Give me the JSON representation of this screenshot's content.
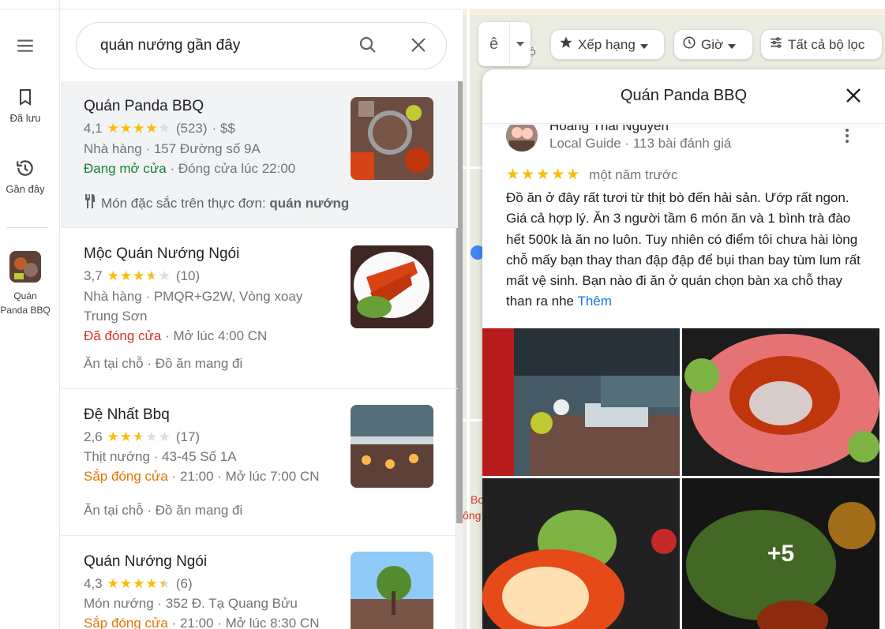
{
  "rail": {
    "saved_label": "Đã lưu",
    "recent_label": "Gần đây",
    "recent_place_label": "Quán Panda BBQ"
  },
  "search": {
    "value": "quán nướng gần đây"
  },
  "results": [
    {
      "title": "Quán Panda BBQ",
      "rating": "4,1",
      "stars": 4.1,
      "count": "(523)",
      "price": "· $$",
      "category_address": "Nhà hàng · 157 Đường số 9A",
      "status": "Đang mở cửa",
      "status_extra": " · Đóng cửa lúc 22:00",
      "menu_prefix": "Món đặc sắc trên thực đơn: ",
      "menu_item": "quán nướng"
    },
    {
      "title": "Mộc Quán Nướng Ngói",
      "rating": "3,7",
      "stars": 3.7,
      "count": "(10)",
      "category_address": "Nhà hàng · PMQR+G2W, Vòng xoay",
      "category_address_2": "Trung Sơn",
      "status": "Đã đóng cửa",
      "status_extra": " · Mở lúc 4:00 CN",
      "services": "Ăn tại chỗ · Đồ ăn mang đi"
    },
    {
      "title": "Đệ Nhất Bbq",
      "rating": "2,6",
      "stars": 2.6,
      "count": "(17)",
      "category_address": "Thịt nướng · 43-45 Số 1A",
      "status": "Sắp đóng cửa",
      "status_extra": " · 21:00 · Mở lúc 7:00 CN",
      "services": "Ăn tại chỗ · Đồ ăn mang đi"
    },
    {
      "title": "Quán Nướng Ngói",
      "rating": "4,3",
      "stars": 4.3,
      "count": "(6)",
      "category_address": "Món nướng · 352 Đ. Tạ Quang Bửu",
      "status": "Sắp đóng cửa",
      "status_extra": " · 21:00 · Mở lúc 8:30 CN"
    }
  ],
  "map_controls": {
    "layer_label": "ê",
    "chip_rank": "Xếp hạng",
    "chip_hours": "Giờ",
    "chip_filters": "Tất cả bộ lọc"
  },
  "map_labels": {
    "lo": "LỘ",
    "bo": "Bo",
    "ong": "ông"
  },
  "panel": {
    "title": "Quán Panda BBQ",
    "reviewer_name": "Hoàng Thái Nguyễn",
    "reviewer_meta": "Local Guide · 113 bài đánh giá",
    "review_stars": 5,
    "review_time": "một năm trước",
    "review_text": "Đồ ăn ở đây rất tươi từ thịt bò đến hải sản. Ướp rất ngon. Giá cả hợp lý. Ăn 3 người tầm 6 món ăn và 1 bình trà đào hết 500k là ăn no luôn. Tuy nhiên có điểm tôi chưa hài lòng chỗ mấy bạn thay than đập đập để bụi than bay tùm lum rất mất vệ sinh. Bạn nào đi ăn ở quán chọn bàn xa chỗ thay than ra nhe ",
    "review_more": "Thêm",
    "photos_more": "+5"
  },
  "colors": {
    "star": "#fbbc04",
    "open": "#188038",
    "closed": "#d93025",
    "closing_soon": "#e37400",
    "link": "#1a73e8"
  }
}
